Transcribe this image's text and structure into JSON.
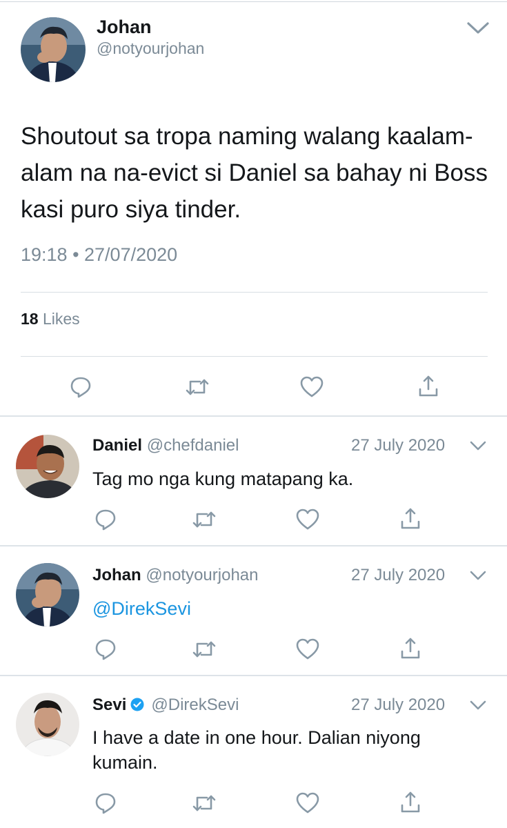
{
  "main_tweet": {
    "author_name": "Johan",
    "author_handle": "@notyourjohan",
    "text": "Shoutout sa tropa naming walang kaalam-alam na na-evict si Daniel sa bahay ni Boss kasi puro siya tinder.",
    "timestamp": "19:18 • 27/07/2020",
    "likes_count": "18",
    "likes_label": "Likes"
  },
  "replies": [
    {
      "author_name": "Daniel",
      "author_handle": "@chefdaniel",
      "date": "27 July 2020",
      "text": "Tag mo nga kung matapang ka.",
      "verified": false
    },
    {
      "author_name": "Johan",
      "author_handle": "@notyourjohan",
      "date": "27 July 2020",
      "text": "@DirekSevi",
      "verified": false
    },
    {
      "author_name": "Sevi",
      "author_handle": "@DirekSevi",
      "date": "27 July 2020",
      "text": "I have a date in one hour. Dalian niyong kumain.",
      "verified": true
    }
  ],
  "colors": {
    "text": "#14171a",
    "secondary": "#7b8a96",
    "link": "#1b95e0",
    "icon": "#8899a6",
    "divider": "#dde3e8"
  },
  "icons": {
    "reply": "reply-icon",
    "retweet": "retweet-icon",
    "like": "heart-icon",
    "share": "share-icon",
    "menu": "chevron-down-icon",
    "verified": "verified-badge-icon"
  }
}
